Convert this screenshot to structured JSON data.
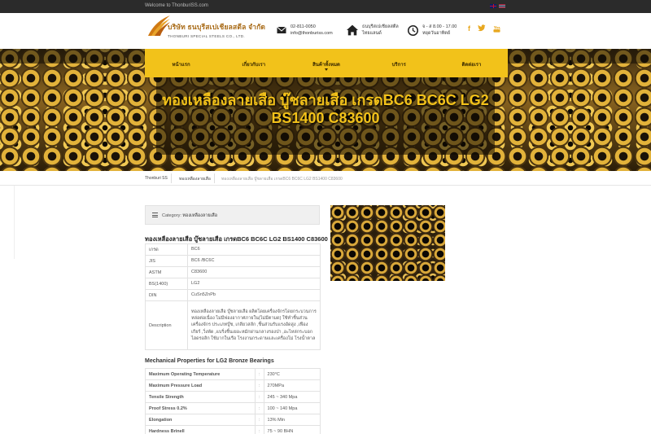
{
  "topbar": {
    "welcome": "Welcome to ThonburiSS.com"
  },
  "brand": {
    "name_th": "บริษัท ธนบุรีสเปเชียลสตีล จำกัด",
    "name_en": "THONBURI SPECIAL STEELS CO., LTD."
  },
  "contact": {
    "phone": "02-811-0050",
    "email": "info@thonburiss.com",
    "company": "ธนบุรีสเปเชียลสตีล",
    "area": "ไทยแลนด์",
    "hours": "จ - ส 8.00 - 17.00",
    "holiday": "หยุดวันอาทิตย์"
  },
  "social": [
    "f",
    "t",
    "y"
  ],
  "nav": [
    {
      "label": "หน้าแรก",
      "dropdown": false
    },
    {
      "label": "เกี่ยวกับเรา",
      "dropdown": false
    },
    {
      "label": "สินค้าทั้งหมด",
      "dropdown": true
    },
    {
      "label": "บริการ",
      "dropdown": false
    },
    {
      "label": "ติดต่อเรา",
      "dropdown": false
    }
  ],
  "hero": {
    "title": "ทองเหลืองลายเสือ บู๊ชลายเสือ เกรดBC6 BC6C LG2 BS1400 C83600"
  },
  "breadcrumb": [
    "Thonburi SS",
    "ทองเหลืองลายเสือ",
    "ทองเหลืองลายเสือ บู๊ชลายเสือ เกรดBC6 BC6C LG2 BS1400 C83600"
  ],
  "category": {
    "label": "Category:",
    "value": "ทองเหลืองลายเสือ"
  },
  "product": {
    "title": "ทองเหลืองลายเสือ บู๊ชลายเสือ เกรดBC6 BC6C LG2 BS1400 C83600",
    "specs": [
      {
        "k": "เกรด",
        "v": "BC6"
      },
      {
        "k": "JIS",
        "v": "BC6 /BC6C"
      },
      {
        "k": "ASTM",
        "v": "C83600"
      },
      {
        "k": "BS(1400)",
        "v": "LG2"
      },
      {
        "k": "DIN",
        "v": "CuSn5ZnPb"
      },
      {
        "k": "Description",
        "v": "ทองเหลืองลายเสือ บู๊ชลายเสือ ผลิตโดยเครื่องจักรโดยกระบวนการหล่อต่อเนื่อง ไม่มีฟองอากาศภายใน(ไม่มีตามด) ใช้ทำชิ้นส่วนเครื่องจักร ประเภทบู๊ช, เกลียวสลัก ,ชิ้นส่วนรับแรงอัดสูง ,เฟืองเกียร์ ,วิ่งพัด ,แบริ่งชิ้นเยอะหมักผ่านกลางรองป่า ,อะไหล่กระบอกไฮดรอลิก ใช้มากในเรือ โรงงานกระดาษและเครื่องโม่ โรงน้ำตาล"
      }
    ]
  },
  "mechanical": {
    "title": "Mechanical Properties for LG2 Bronze Bearings",
    "rows": [
      {
        "k": "Maximum Operating Temperature",
        "v": "230°C"
      },
      {
        "k": "Maximum Pressure Load",
        "v": "270MPa"
      },
      {
        "k": "Tensile Strength",
        "v": "245 ~ 340 Mpa"
      },
      {
        "k": "Proof Stress 0.2%",
        "v": "100 ~ 140 Mpa"
      },
      {
        "k": "Elongation",
        "v": "13% Min"
      },
      {
        "k": "Hardness Brinell",
        "v": "75 ~ 90 BHN"
      }
    ]
  },
  "colors": {
    "accent": "#f2c21a",
    "topbar": "#2b2b2b"
  }
}
